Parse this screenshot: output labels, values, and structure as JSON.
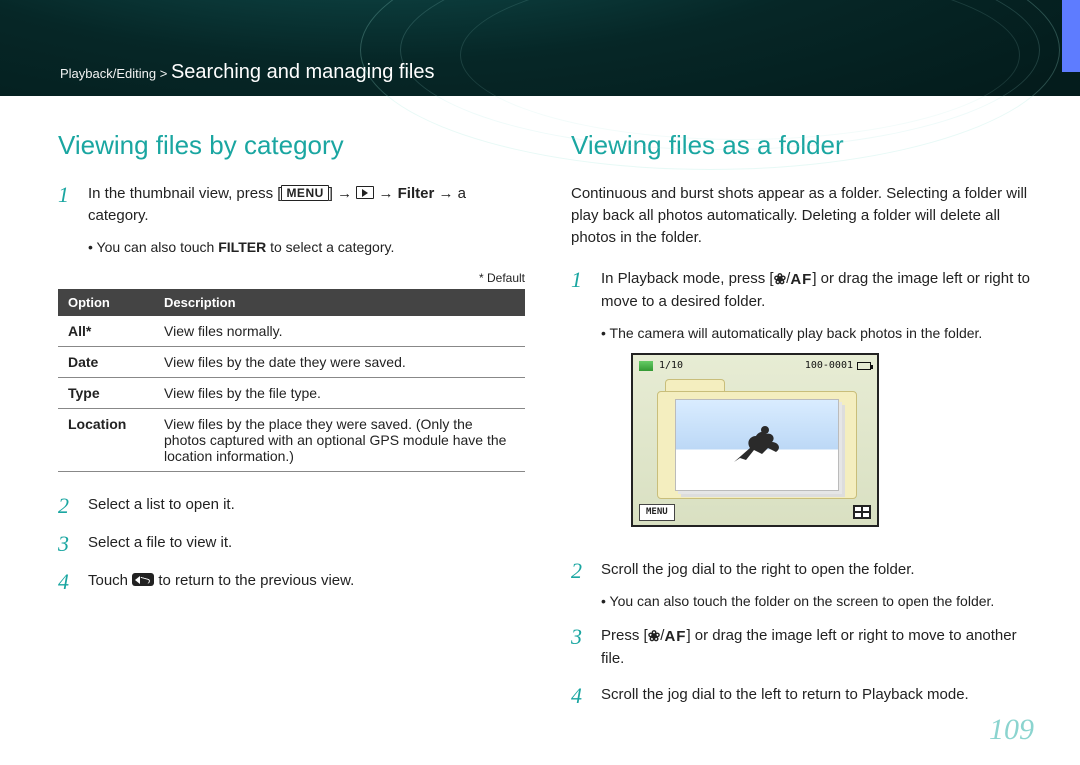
{
  "breadcrumb": {
    "section": "Playback/Editing",
    "sep": " > ",
    "title": "Searching and managing files"
  },
  "left": {
    "heading": "Viewing files by category",
    "step1_a": "In the thumbnail view, press [",
    "step1_b": "] → ",
    "step1_c": " → ",
    "step1_filter": "Filter",
    "step1_d": " → a category.",
    "step1_bullet_a": "You can also touch ",
    "step1_bullet_filter": "FILTER",
    "step1_bullet_b": " to select a category.",
    "default_note": "* Default",
    "table": {
      "headers": [
        "Option",
        "Description"
      ],
      "rows": [
        {
          "opt": "All*",
          "desc": "View files normally."
        },
        {
          "opt": "Date",
          "desc": "View files by the date they were saved."
        },
        {
          "opt": "Type",
          "desc": "View files by the file type."
        },
        {
          "opt": "Location",
          "desc": "View files by the place they were saved. (Only the photos captured with an optional GPS module have the location information.)"
        }
      ]
    },
    "step2": "Select a list to open it.",
    "step3": "Select a file to view it.",
    "step4_a": "Touch ",
    "step4_b": " to return to the previous view."
  },
  "right": {
    "heading": "Viewing files as a folder",
    "intro": "Continuous and burst shots appear as a folder. Selecting a folder will play back all photos automatically. Deleting a folder will delete all photos in the folder.",
    "step1_a": "In Playback mode, press [",
    "step1_slash": "/",
    "step1_b": "] or drag the image left or right to move to a desired folder.",
    "step1_bullet": "The camera will automatically play back photos in the folder.",
    "lcd": {
      "counter": "1/10",
      "fileid": "100-0001",
      "menu": "MENU"
    },
    "step2": "Scroll the jog dial to the right to open the folder.",
    "step2_bullet": "You can also touch the folder on the screen to open the folder.",
    "step3_a": "Press [",
    "step3_slash": "/",
    "step3_b": "] or drag the image left or right to move to another file.",
    "step4": "Scroll the jog dial to the left to return to Playback mode."
  },
  "page_number": "109"
}
